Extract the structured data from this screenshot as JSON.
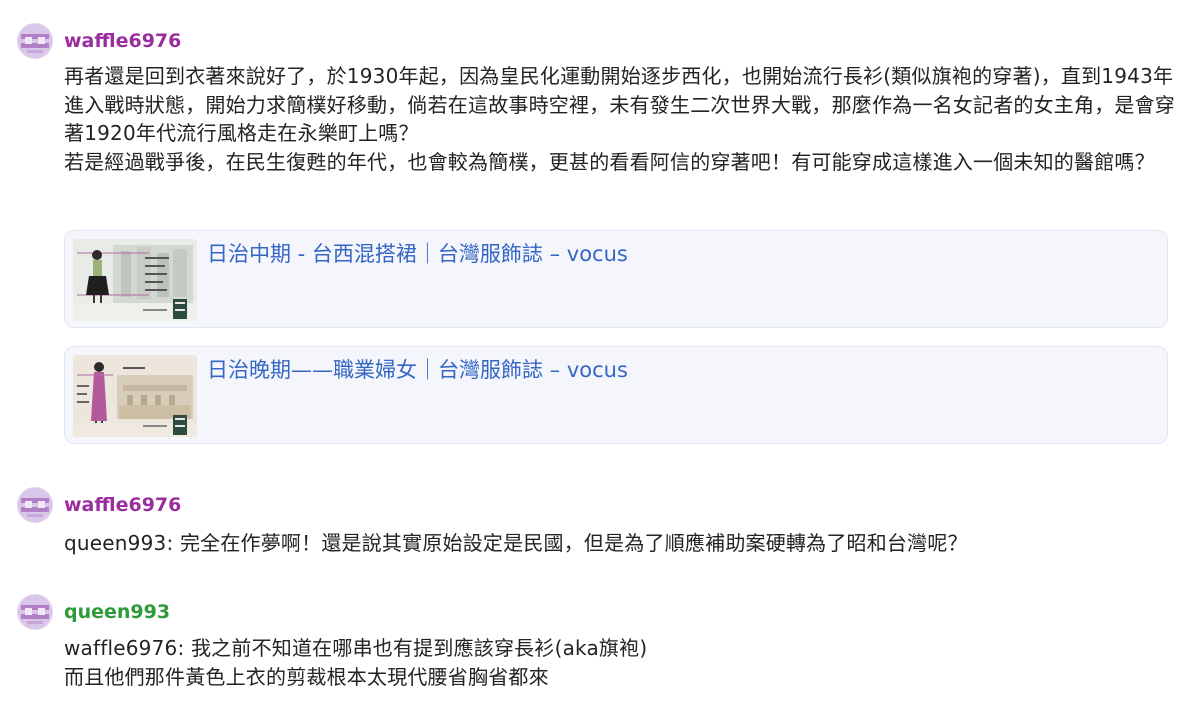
{
  "comments": [
    {
      "username": "waffle6976",
      "username_color": "#9a2e9e",
      "paragraphs": [
        "再者還是回到衣著來說好了，於1930年起，因為皇民化運動開始逐步西化，也開始流行長衫(類似旗袍的穿著)，直到1943年進入戰時狀態，開始力求簡樸好移動，倘若在這故事時空裡，未有發生二次世界大戰，那麼作為一名女記者的女主角，是會穿著1920年代流行風格走在永樂町上嗎？",
        "若是經過戰爭後，在民生復甦的年代，也會較為簡樸，更甚的看看阿信的穿著吧！有可能穿成這樣進入一個未知的醫館嗎？"
      ],
      "links": [
        {
          "title": "日治中期 - 台西混搭裙｜台灣服飾誌 – vocus",
          "thumb_tag": "日治中期",
          "thumb_caption": "台西混搭裙"
        },
        {
          "title": "日治晚期——職業婦女｜台灣服飾誌 – vocus",
          "thumb_tag": "日治晚期",
          "thumb_caption": "職業婦女"
        }
      ]
    },
    {
      "username": "waffle6976",
      "username_color": "#9a2e9e",
      "reply_to": "queen993",
      "text": "完全在作夢啊！還是說其實原始設定是民國，但是為了順應補助案硬轉為了昭和台灣呢？"
    },
    {
      "username": "queen993",
      "username_color": "#2e9a3a",
      "reply_to": "waffle6976",
      "lines": [
        "我之前不知道在哪串也有提到應該穿長衫(aka旗袍)",
        "而且他們那件黃色上衣的剪裁根本太現代腰省胸省都來"
      ]
    }
  ],
  "icons": {
    "avatar": "avatar-icon"
  }
}
